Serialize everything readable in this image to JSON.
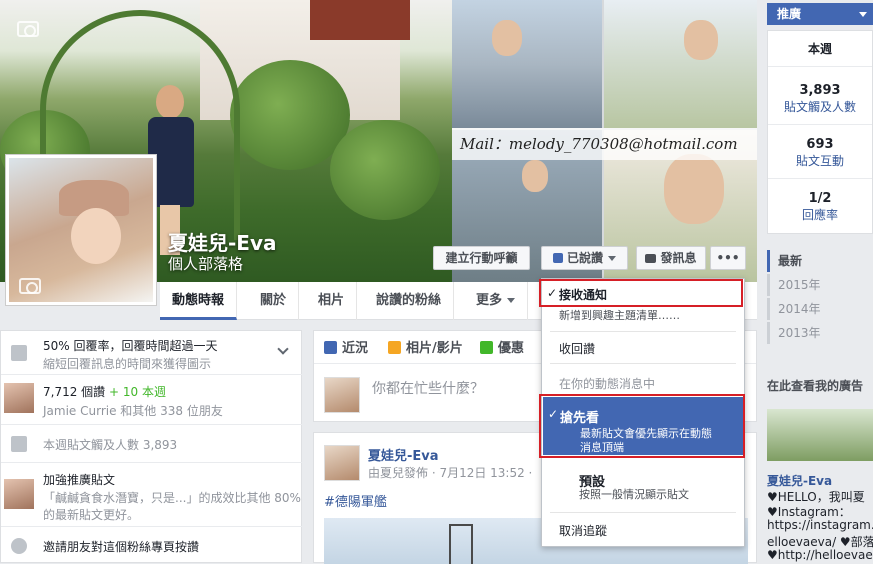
{
  "cover": {
    "email_overlay": "Mail：melody_770308@hotmail.com"
  },
  "page": {
    "name": "夏娃兒-Eva",
    "category": "個人部落格"
  },
  "cover_buttons": {
    "cta": "建立行動呼籲",
    "liked": "已說讚",
    "message": "發訊息",
    "more": "•••"
  },
  "nav": {
    "tabs": [
      "動態時報",
      "關於",
      "相片",
      "說讚的粉絲",
      "更多"
    ]
  },
  "left": {
    "response": {
      "title": "50% 回覆率，回覆時間超過一天",
      "sub": "縮短回覆訊息的時間來獲得圖示"
    },
    "likes": {
      "count": "7,712 個讚",
      "new": "+ 10 本週",
      "friends": "Jamie Currie 和其他 338 位朋友"
    },
    "reach": "本週貼文觸及人數 3,893",
    "boost": {
      "title": "加強推廣貼文",
      "line1": "「鹹鹹貪食水潛寶，只是...」的成效比其他 80%",
      "line2": "的最新貼文更好。"
    },
    "invite": "邀請朋友對這個粉絲專頁按讚"
  },
  "composer": {
    "tabs": [
      "近況",
      "相片/影片",
      "優惠"
    ],
    "placeholder": "你都在忙些什麼？"
  },
  "post": {
    "author": "夏娃兒-Eva",
    "meta": "由夏兒發佈 · 7月12日 13:52 ·",
    "hashtag": "#德陽軍艦"
  },
  "dropdown": {
    "receive": "接收通知",
    "add_list": "新增到興趣主題清單……",
    "unlike": "收回讚",
    "section": "在你的動態消息中",
    "see_first": "搶先看",
    "see_first_desc1": "最新貼文會優先顯示在動態",
    "see_first_desc2": "消息頂端",
    "default": "預設",
    "default_desc": "按照一般情況顯示貼文",
    "unfollow": "取消追蹤"
  },
  "right": {
    "header": "推廣",
    "this_week": "本週",
    "stats": [
      {
        "value": "3,893",
        "label1": "貼文觸及人數",
        "label2": ""
      },
      {
        "value": "693",
        "label1": "貼文互動",
        "label2": ""
      },
      {
        "value": "1/2",
        "label1": "回應率",
        "label2": ""
      }
    ],
    "years": [
      "最新",
      "2015年",
      "2014年",
      "2013年"
    ],
    "ads_title": "在此查看我的廣告",
    "ad_name": "夏娃兒-Eva",
    "ad_lines": [
      "♥HELLO，我叫夏",
      "♥Instagram：",
      "https://instagram.co",
      "elloevaeva/ ♥部落格",
      "♥http://helloevaeva.pi"
    ]
  }
}
